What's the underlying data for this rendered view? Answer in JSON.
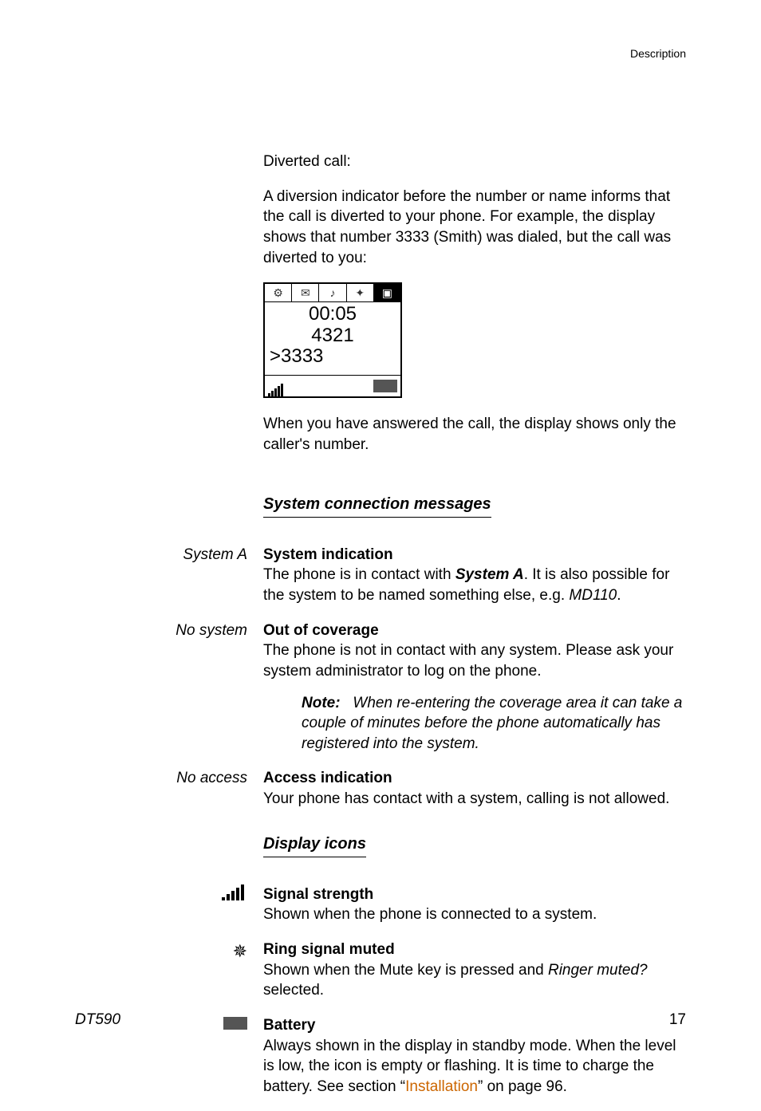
{
  "header": {
    "section_label": "Description"
  },
  "diverted": {
    "heading": "Diverted call:",
    "para1": "A diversion indicator before the number or name informs that the call is diverted to your phone. For example, the display shows that number 3333 (Smith) was dialed, but the call was diverted to you:",
    "lcd": {
      "time": "00:05",
      "number": "4321",
      "diverted": ">3333"
    },
    "para2": "When you have answered the call, the display shows only the caller's number."
  },
  "scm": {
    "title": "System connection messages",
    "items": [
      {
        "left": "System A",
        "title": "System indication",
        "body_pre": "The phone is in contact with ",
        "body_em1": "System A",
        "body_mid": ". It is also possible for the system to be named something else, e.g. ",
        "body_em2": "MD110",
        "body_post": "."
      },
      {
        "left": "No system",
        "title": "Out of coverage",
        "body": "The phone is not in contact with any system. Please ask your system administrator to log on the phone.",
        "note_label": "Note:",
        "note_body": "When re-entering the coverage area it can take a couple of minutes before the phone automatically has registered into the system."
      },
      {
        "left": "No access",
        "title": "Access indication",
        "body": "Your phone has contact with a system, calling is not allowed."
      }
    ]
  },
  "icons": {
    "title": "Display icons",
    "items": [
      {
        "icon": "signal",
        "title": "Signal strength",
        "body": "Shown when the phone is connected to a system."
      },
      {
        "icon": "mute",
        "title": "Ring signal muted",
        "body_pre": "Shown when the Mute key is pressed and ",
        "body_em": "Ringer muted?",
        "body_post": " selected."
      },
      {
        "icon": "battery",
        "title": "Battery",
        "body_pre": "Always shown in the display in standby mode. When the level is low, the icon is empty or flashing. It is time to charge the battery. See section “",
        "link": "Installation",
        "body_post": "” on page 96."
      }
    ]
  },
  "footer": {
    "model": "DT590",
    "page": "17"
  }
}
